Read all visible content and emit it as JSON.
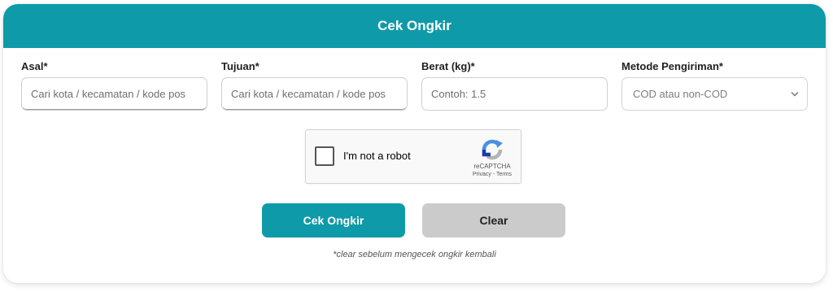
{
  "header": {
    "title": "Cek Ongkir"
  },
  "form": {
    "origin": {
      "label": "Asal*",
      "placeholder": "Cari kota / kecamatan / kode pos",
      "value": ""
    },
    "destination": {
      "label": "Tujuan*",
      "placeholder": "Cari kota / kecamatan / kode pos",
      "value": ""
    },
    "weight": {
      "label": "Berat (kg)*",
      "placeholder": "Contoh: 1.5",
      "value": ""
    },
    "shipping_method": {
      "label": "Metode Pengiriman*",
      "placeholder": "COD atau non-COD"
    }
  },
  "captcha": {
    "label": "I'm not a robot",
    "brand": "reCAPTCHA",
    "privacy": "Privacy",
    "separator": " - ",
    "terms": "Terms",
    "checked": false
  },
  "actions": {
    "check_label": "Cek Ongkir",
    "clear_label": "Clear"
  },
  "note": "*clear sebelum mengecek ongkir kembali",
  "colors": {
    "accent": "#0f9aa9",
    "clear_button": "#cbcbcb",
    "recaptcha_blue": "#4a90e2",
    "recaptcha_dark_blue": "#1c3aa9",
    "recaptcha_gray": "#b3b3b3"
  },
  "icons": {
    "select_arrow": "chevron-down-icon",
    "captcha_logo": "recaptcha-logo-icon"
  }
}
